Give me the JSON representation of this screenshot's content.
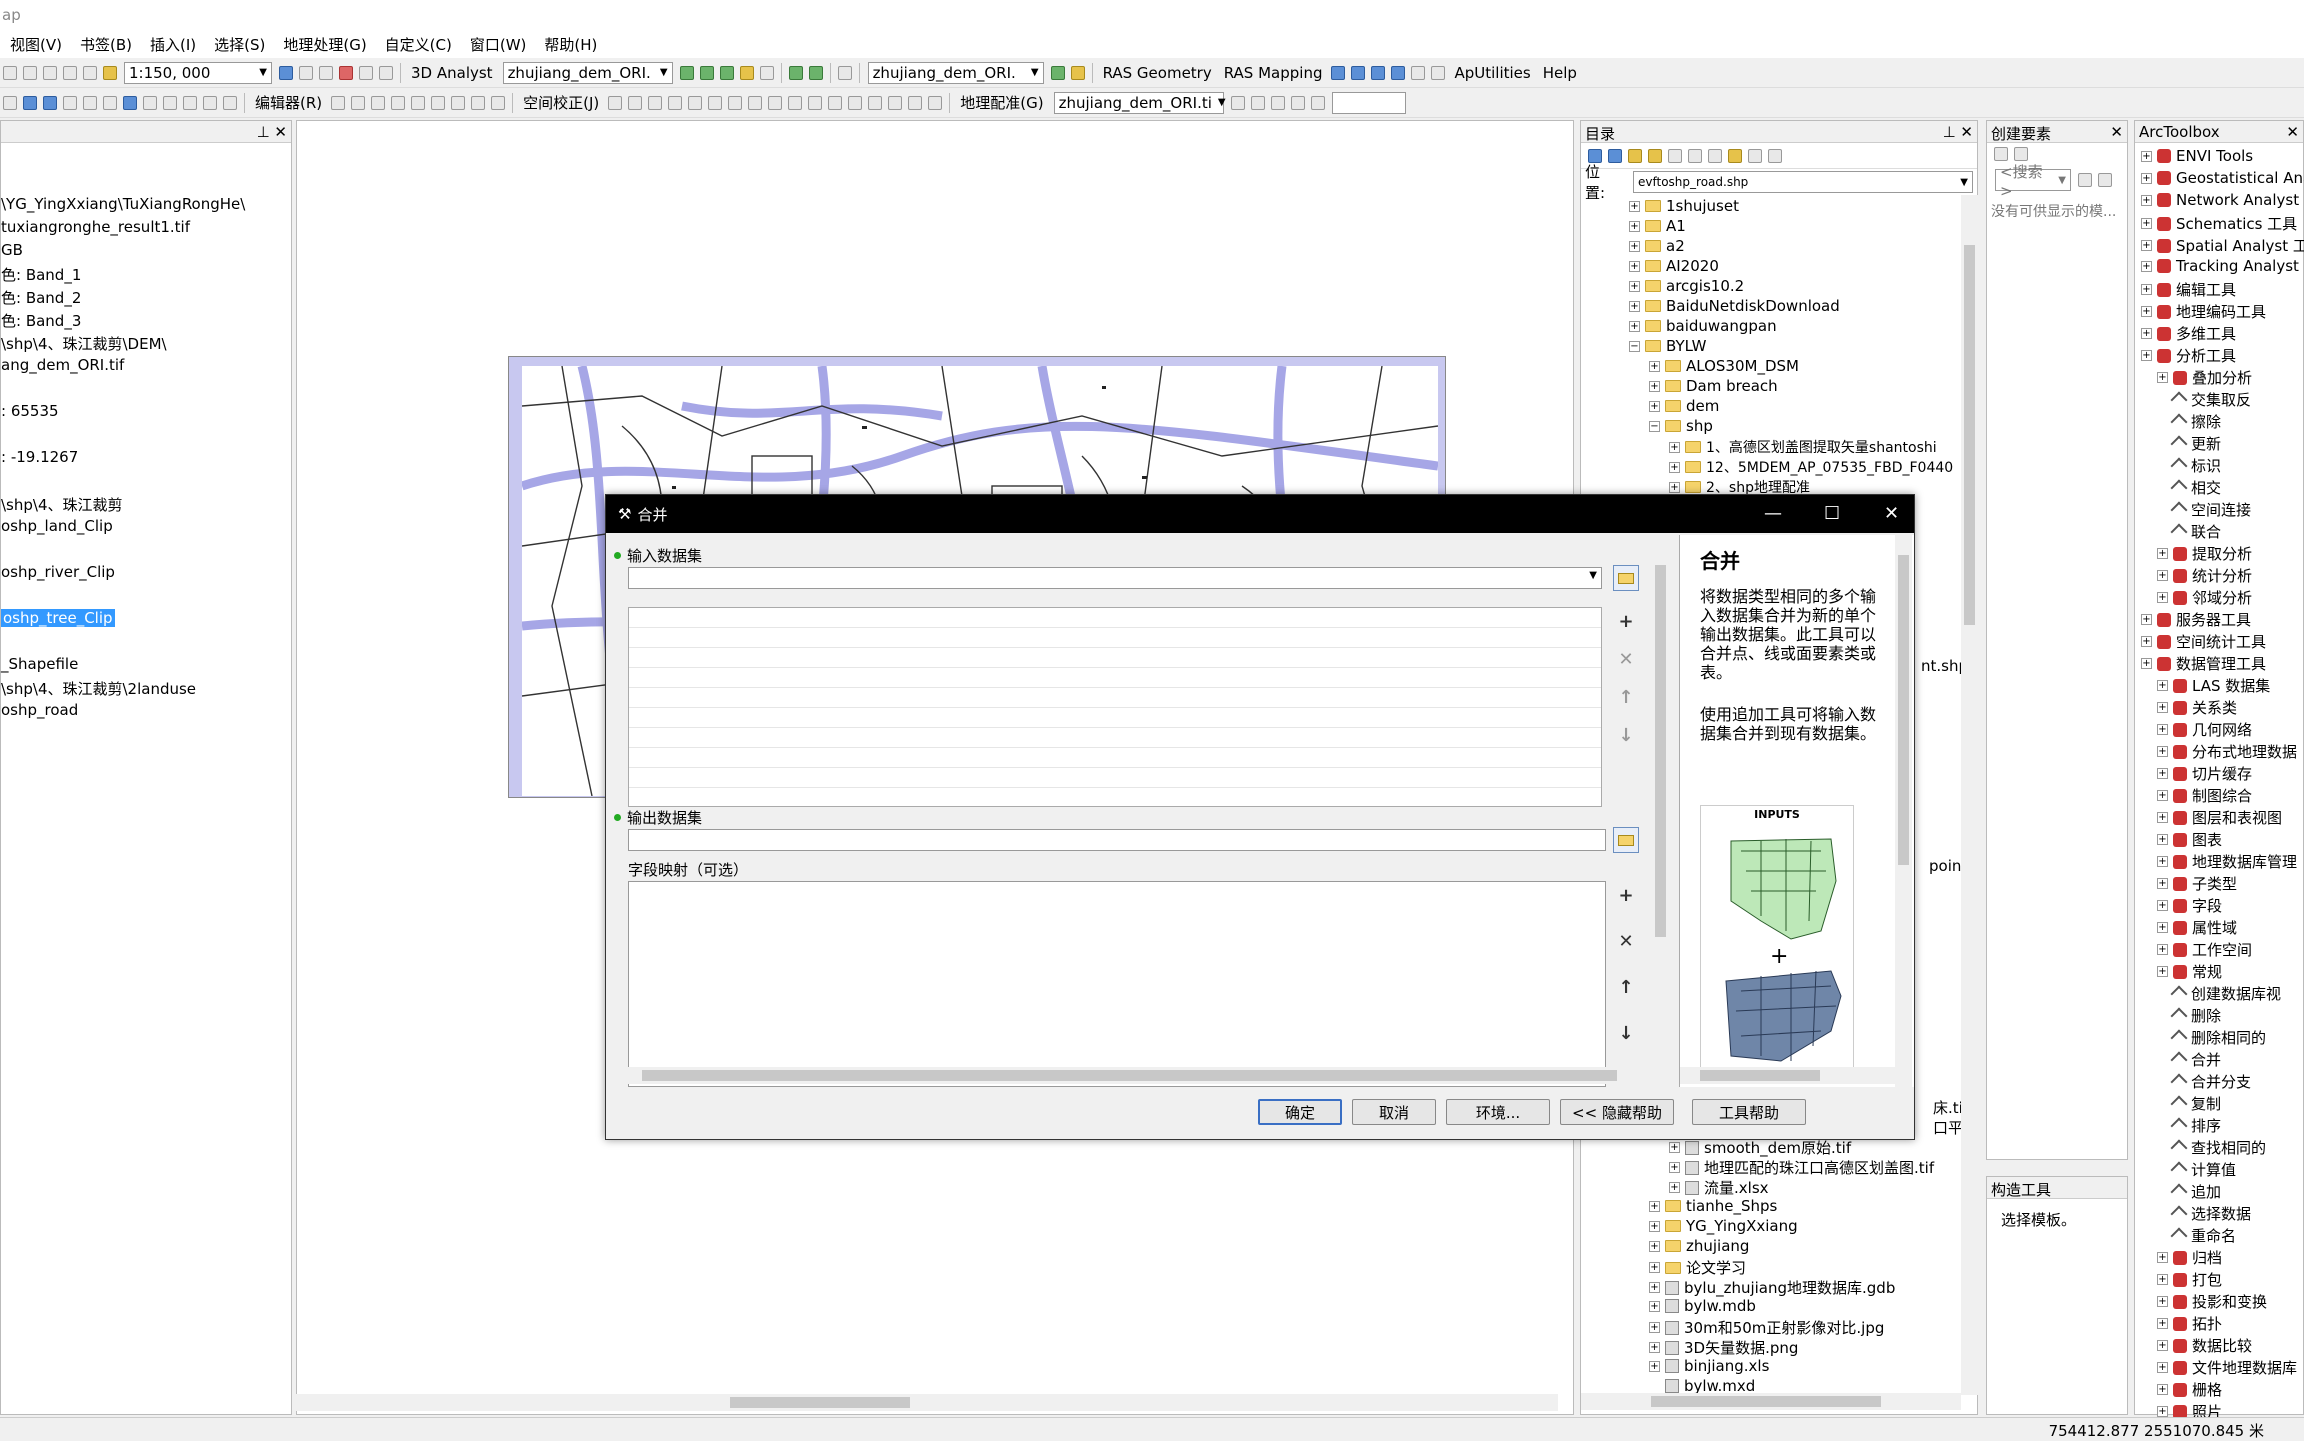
{
  "titlebar": {
    "title": "ap"
  },
  "menu": [
    "视图(V)",
    "书签(B)",
    "插入(I)",
    "选择(S)",
    "地理处理(G)",
    "自定义(C)",
    "窗口(W)",
    "帮助(H)"
  ],
  "toolbar1": {
    "scale": "1:150, 000",
    "analyst": "3D Analyst",
    "layer1": "zhujiang_dem_ORI.",
    "layer2": "zhujiang_dem_ORI.",
    "ras_geometry": "RAS Geometry",
    "ras_mapping": "RAS Mapping",
    "aputilities": "ApUtilities",
    "help": "Help"
  },
  "toolbar2": {
    "editor": "编辑器(R)",
    "spatial_adjust": "空间校正(J)",
    "georef": "地理配准(G)",
    "georef_layer": "zhujiang_dem_ORI.ti"
  },
  "toc": {
    "lines": [
      "\\YG_YingXxiang\\TuXiangRongHe\\",
      "tuxiangronghe_result1.tif",
      "GB",
      "色:   Band_1",
      "色: Band_2",
      "色:  Band_3",
      "\\shp\\4、珠江裁剪\\DEM\\",
      "ang_dem_ORI.tif",
      ": 65535",
      ": -19.1267",
      "\\shp\\4、珠江裁剪",
      "oshp_land_Clip",
      "oshp_river_Clip",
      "oshp_tree_Clip",
      "_Shapefile",
      "\\shp\\4、珠江裁剪\\2landuse",
      "oshp_road"
    ]
  },
  "catalog": {
    "title": "目录",
    "location_label": "位置:",
    "location_value": "evftoshp_road.shp",
    "items": [
      "1shujuset",
      "A1",
      "a2",
      "AI2020",
      "arcgis10.2",
      "BaiduNetdiskDownload",
      "baiduwangpan",
      "BYLW",
      "ALOS30M_DSM",
      "Dam breach",
      "dem",
      "shp",
      "1、高德区划盖图提取矢量shantoshi",
      "12、5MDEM_AP_07535_FBD_F0440",
      "2、shp地理配准"
    ],
    "partial": {
      "shp_right": "nt.shp",
      "points_right": "points",
      "tif_right": "床.tif",
      "smooth_right": "口平滑"
    },
    "items_bottom": [
      "smooth_dem原始.tif",
      "地理匹配的珠江口高德区划盖图.tif",
      "流量.xlsx",
      "tianhe_Shps",
      "YG_YingXxiang",
      "zhujiang",
      "论文学习",
      "bylu_zhujiang地理数据库.gdb",
      "bylw.mdb",
      "30m和50m正射影像对比.jpg",
      "3D矢量数据.png",
      "binjiang.xls",
      "bylw.mxd"
    ]
  },
  "create_features": {
    "title": "创建要素",
    "search": "<搜索>",
    "empty": "没有可供显示的模...",
    "construct_title": "构造工具",
    "construct_hint": "选择模板。"
  },
  "toolbox": {
    "title": "ArcToolbox",
    "items": [
      {
        "t": "ENVI Tools",
        "lvl": 0,
        "kind": "box"
      },
      {
        "t": "Geostatistical Ana",
        "lvl": 0,
        "kind": "box"
      },
      {
        "t": "Network Analyst",
        "lvl": 0,
        "kind": "box"
      },
      {
        "t": "Schematics 工具",
        "lvl": 0,
        "kind": "box"
      },
      {
        "t": "Spatial Analyst 工",
        "lvl": 0,
        "kind": "box"
      },
      {
        "t": "Tracking Analyst",
        "lvl": 0,
        "kind": "box"
      },
      {
        "t": "编辑工具",
        "lvl": 0,
        "kind": "box"
      },
      {
        "t": "地理编码工具",
        "lvl": 0,
        "kind": "box"
      },
      {
        "t": "多维工具",
        "lvl": 0,
        "kind": "box"
      },
      {
        "t": "分析工具",
        "lvl": 0,
        "kind": "box"
      },
      {
        "t": "叠加分析",
        "lvl": 1,
        "kind": "box"
      },
      {
        "t": "交集取反",
        "lvl": 2,
        "kind": "tool"
      },
      {
        "t": "擦除",
        "lvl": 2,
        "kind": "tool"
      },
      {
        "t": "更新",
        "lvl": 2,
        "kind": "tool"
      },
      {
        "t": "标识",
        "lvl": 2,
        "kind": "tool"
      },
      {
        "t": "相交",
        "lvl": 2,
        "kind": "tool"
      },
      {
        "t": "空间连接",
        "lvl": 2,
        "kind": "tool"
      },
      {
        "t": "联合",
        "lvl": 2,
        "kind": "tool"
      },
      {
        "t": "提取分析",
        "lvl": 1,
        "kind": "box"
      },
      {
        "t": "统计分析",
        "lvl": 1,
        "kind": "box"
      },
      {
        "t": "邻域分析",
        "lvl": 1,
        "kind": "box"
      },
      {
        "t": "服务器工具",
        "lvl": 0,
        "kind": "box"
      },
      {
        "t": "空间统计工具",
        "lvl": 0,
        "kind": "box"
      },
      {
        "t": "数据管理工具",
        "lvl": 0,
        "kind": "box"
      },
      {
        "t": "LAS 数据集",
        "lvl": 1,
        "kind": "box"
      },
      {
        "t": "关系类",
        "lvl": 1,
        "kind": "box"
      },
      {
        "t": "几何网络",
        "lvl": 1,
        "kind": "box"
      },
      {
        "t": "分布式地理数据",
        "lvl": 1,
        "kind": "box"
      },
      {
        "t": "切片缓存",
        "lvl": 1,
        "kind": "box"
      },
      {
        "t": "制图综合",
        "lvl": 1,
        "kind": "box"
      },
      {
        "t": "图层和表视图",
        "lvl": 1,
        "kind": "box"
      },
      {
        "t": "图表",
        "lvl": 1,
        "kind": "box"
      },
      {
        "t": "地理数据库管理",
        "lvl": 1,
        "kind": "box"
      },
      {
        "t": "子类型",
        "lvl": 1,
        "kind": "box"
      },
      {
        "t": "字段",
        "lvl": 1,
        "kind": "box"
      },
      {
        "t": "属性域",
        "lvl": 1,
        "kind": "box"
      },
      {
        "t": "工作空间",
        "lvl": 1,
        "kind": "box"
      },
      {
        "t": "常规",
        "lvl": 1,
        "kind": "box"
      },
      {
        "t": "创建数据库视",
        "lvl": 2,
        "kind": "tool"
      },
      {
        "t": "删除",
        "lvl": 2,
        "kind": "tool"
      },
      {
        "t": "删除相同的",
        "lvl": 2,
        "kind": "tool"
      },
      {
        "t": "合并",
        "lvl": 2,
        "kind": "tool"
      },
      {
        "t": "合并分支",
        "lvl": 2,
        "kind": "tool"
      },
      {
        "t": "复制",
        "lvl": 2,
        "kind": "tool"
      },
      {
        "t": "排序",
        "lvl": 2,
        "kind": "tool"
      },
      {
        "t": "查找相同的",
        "lvl": 2,
        "kind": "tool"
      },
      {
        "t": "计算值",
        "lvl": 2,
        "kind": "tool"
      },
      {
        "t": "追加",
        "lvl": 2,
        "kind": "tool"
      },
      {
        "t": "选择数据",
        "lvl": 2,
        "kind": "tool"
      },
      {
        "t": "重命名",
        "lvl": 2,
        "kind": "tool"
      },
      {
        "t": "归档",
        "lvl": 1,
        "kind": "box"
      },
      {
        "t": "打包",
        "lvl": 1,
        "kind": "box"
      },
      {
        "t": "投影和变换",
        "lvl": 1,
        "kind": "box"
      },
      {
        "t": "拓扑",
        "lvl": 1,
        "kind": "box"
      },
      {
        "t": "数据比较",
        "lvl": 1,
        "kind": "box"
      },
      {
        "t": "文件地理数据库",
        "lvl": 1,
        "kind": "box"
      },
      {
        "t": "栅格",
        "lvl": 1,
        "kind": "box"
      },
      {
        "t": "照片",
        "lvl": 1,
        "kind": "box"
      }
    ]
  },
  "dialog": {
    "title": "合并",
    "input_label": "输入数据集",
    "output_label": "输出数据集",
    "fieldmap_label": "字段映射（可选）",
    "ok": "确定",
    "cancel": "取消",
    "env": "环境...",
    "hide_help": "<< 隐藏帮助",
    "tool_help": "工具帮助",
    "help_title": "合并",
    "help_p1": "将数据类型相同的多个输入数据集合并为新的单个输出数据集。此工具可以合并点、线或面要素类或表。",
    "help_p2": "使用追加工具可将输入数据集合并到现有数据集。",
    "help_img_label": "INPUTS"
  },
  "status": {
    "coords": "754412.877  2551070.845 米"
  }
}
